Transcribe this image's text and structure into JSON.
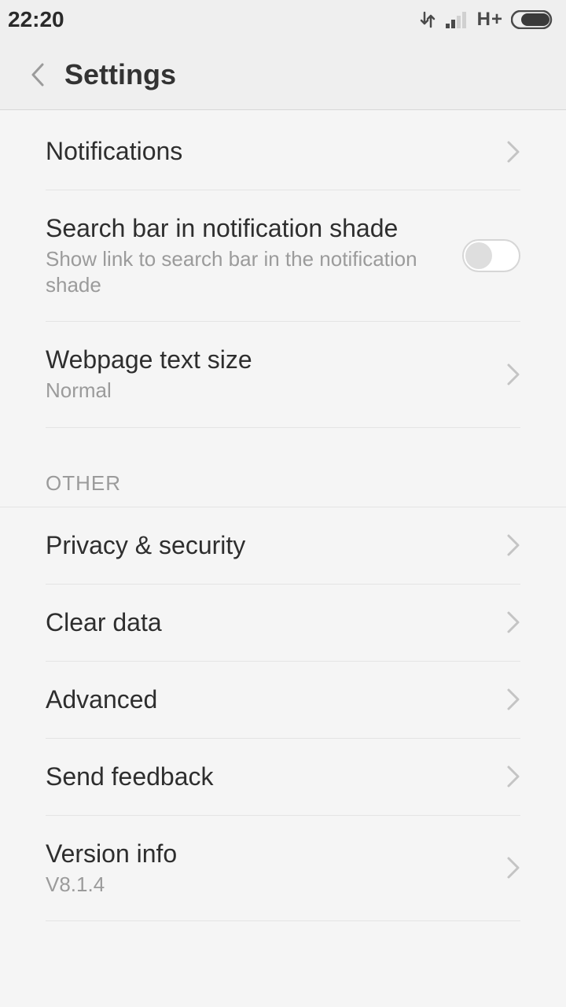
{
  "status": {
    "time": "22:20",
    "network_label": "H+"
  },
  "header": {
    "title": "Settings"
  },
  "rows": {
    "notifications": {
      "title": "Notifications"
    },
    "search_shade": {
      "title": "Search bar in notification shade",
      "sub": "Show link to search bar in the notification shade"
    },
    "text_size": {
      "title": "Webpage text size",
      "sub": "Normal"
    },
    "privacy": {
      "title": "Privacy & security"
    },
    "clear_data": {
      "title": "Clear data"
    },
    "advanced": {
      "title": "Advanced"
    },
    "feedback": {
      "title": "Send feedback"
    },
    "version": {
      "title": "Version info",
      "sub": "V8.1.4"
    }
  },
  "sections": {
    "other": "OTHER"
  }
}
